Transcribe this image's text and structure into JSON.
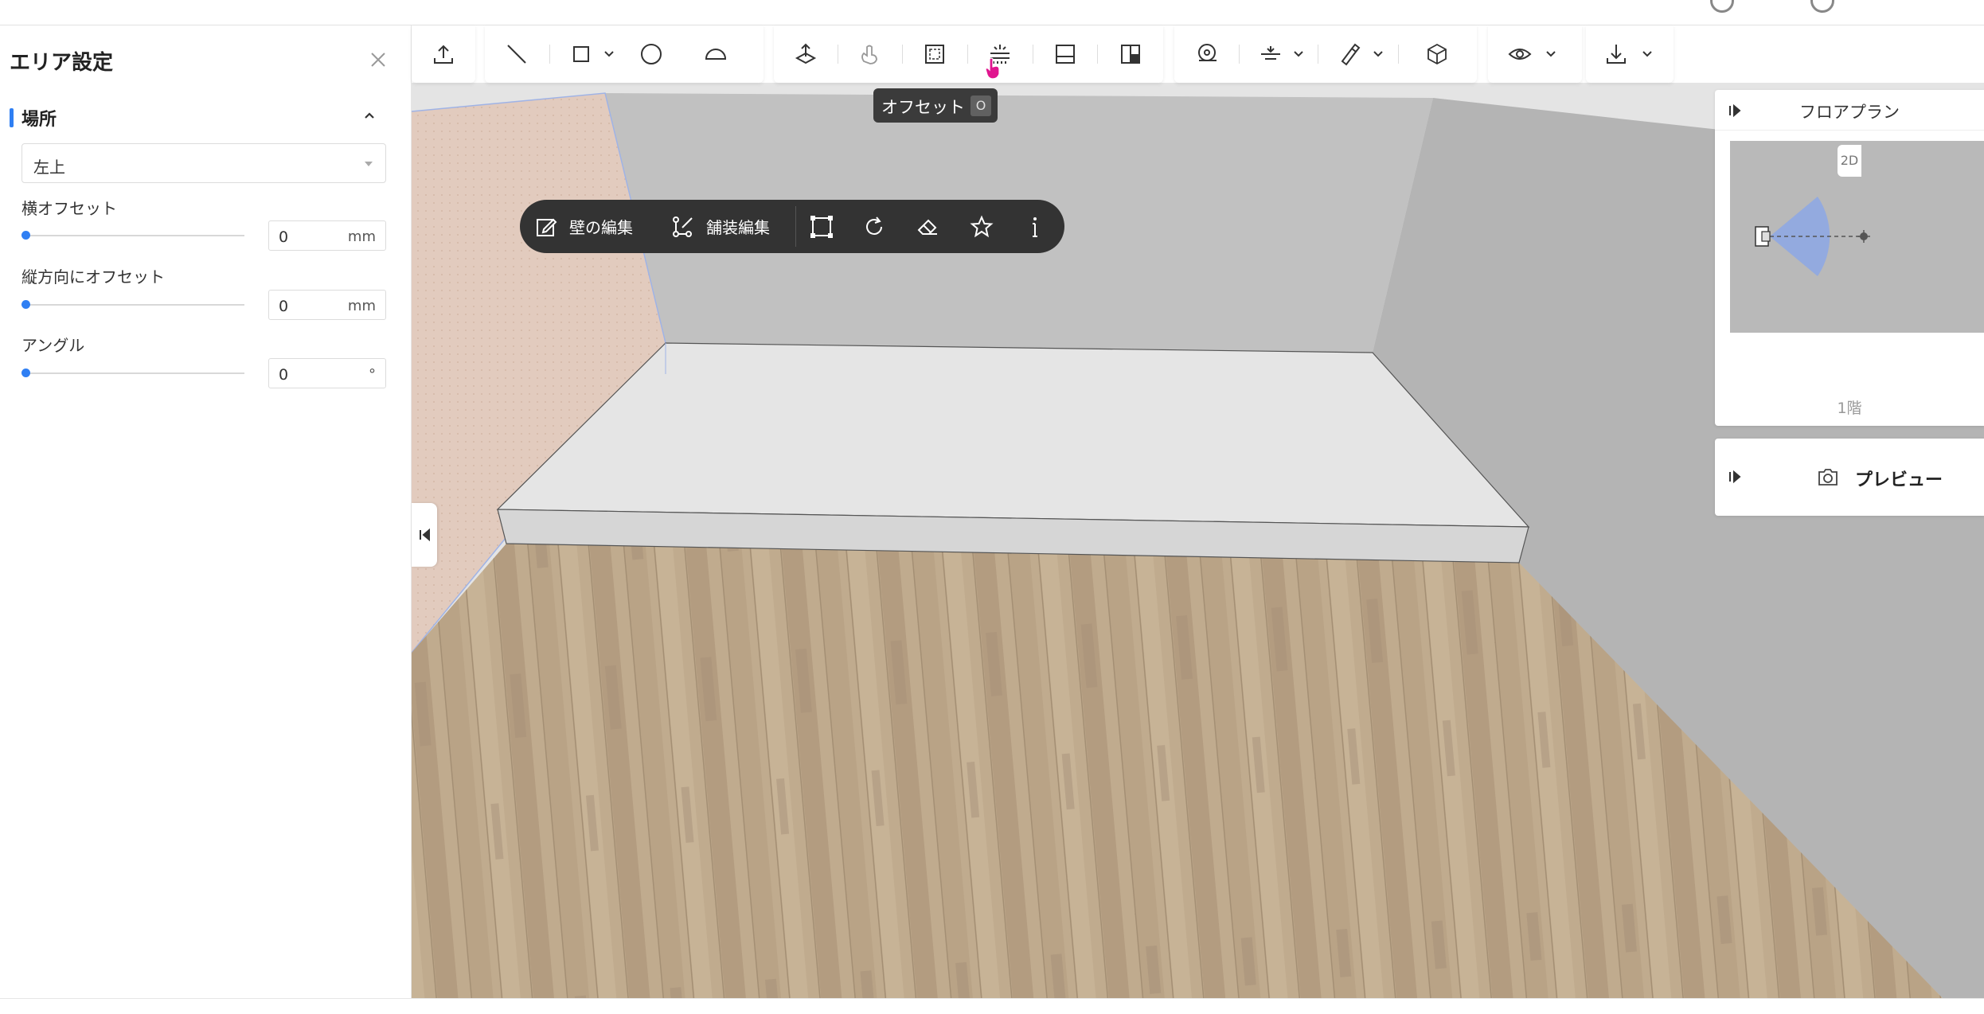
{
  "area_panel": {
    "title": "エリア設定",
    "section_title": "場所",
    "location_value": "左上",
    "fields": [
      {
        "label": "横オフセット",
        "value": "0",
        "unit": "mm",
        "slider_fraction": 0
      },
      {
        "label": "縦方向にオフセット",
        "value": "0",
        "unit": "mm",
        "slider_fraction": 0
      },
      {
        "label": "アングル",
        "value": "0",
        "unit": "°",
        "slider_fraction": 0
      }
    ]
  },
  "toolbar": {
    "tooltip_label": "オフセット",
    "tooltip_shortcut": "O",
    "icons": [
      "upload-icon",
      "line-icon",
      "rectangle-icon",
      "circle-icon",
      "arc-icon",
      "move-up-icon",
      "hand-tool-icon",
      "select-frame-icon",
      "offset-icon",
      "panel-icon",
      "split-panel-icon",
      "tape-measure-icon",
      "align-icon",
      "paint-brush-icon",
      "cube-icon",
      "eye-icon",
      "download-icon"
    ]
  },
  "context_toolbar": {
    "edit_wall": "壁の編集",
    "edit_paving": "舗装編集"
  },
  "floor_plan": {
    "title": "フロアプラン",
    "view_toggle": "2D",
    "floor_label": "1階"
  },
  "preview": {
    "label": "プレビュー"
  },
  "colors": {
    "accent": "#2f7ff3",
    "dark_bar": "#333333",
    "wood_floor": "#c0ab8e"
  }
}
